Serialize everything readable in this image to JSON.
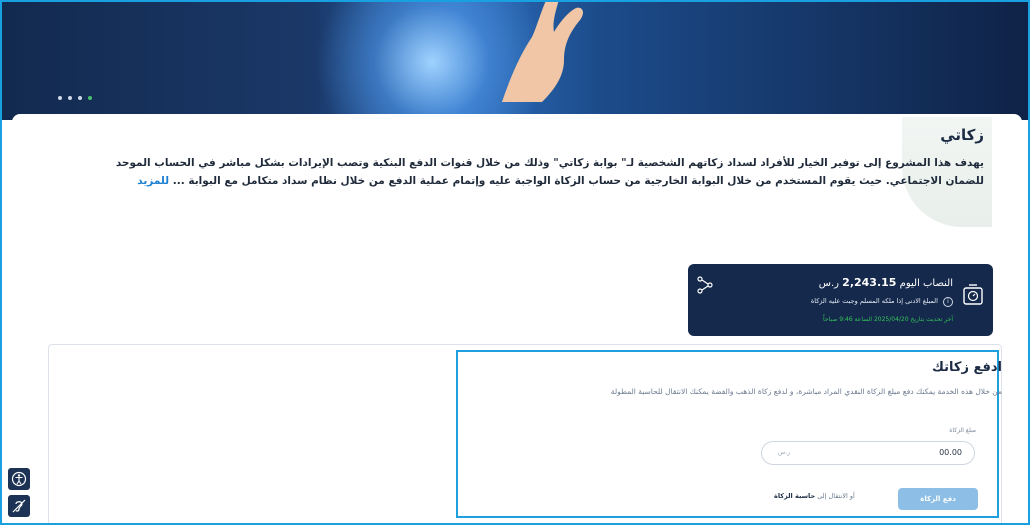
{
  "hero": {
    "slides": 4,
    "active_slide": 4
  },
  "intro": {
    "title": "زكاتي",
    "description": "يهدف هذا المشروع إلى توفير الخيار للأفراد لسداد زكاتهم الشخصية لـ\" بوابة زكاتي\" وذلك من خلال قنوات الدفع البنكية وتصب الإيرادات بشكل مباشر في الحساب الموحد للضمان الاجتماعي. حيث يقوم المستخدم من خلال البوابة الخارجية من حساب الزكاة الواجبة عليه وإتمام عملية الدفع من خلال نظام سداد متكامل مع البوابة ...",
    "more_link": "للمزيد"
  },
  "nisab": {
    "label": "النصاب اليوم",
    "value": "2,243.15",
    "currency": "ر.س",
    "note": "المبلغ الادنى إذا ملكه المسلم وجبت عليه الزكاة",
    "update": "آخر تحديث بتاريخ 2025/04/20 الساعة 9:46 صباحاً"
  },
  "pay": {
    "title": "ادفع زكاتك",
    "description": "من خلال هذه الخدمة يمكنك دفع مبلغ الزكاة النقدي المراد مباشرة، و لدفع زكاة الذهب والفضة يمكنك الانتقال للحاسبة المطولة",
    "amount_label": "مبلغ الزكاة",
    "amount_value": "00.00",
    "currency": "ر.س",
    "button": "دفع الزكاة",
    "calc_prefix": "أو الانتقال إلى",
    "calc_link": "حاسبة الزكاة"
  },
  "colors": {
    "accent": "#1ea0de",
    "navy": "#14294b",
    "green": "#35c45a",
    "link": "#1d7fd1"
  },
  "icons": [
    "scale-icon",
    "share-icon",
    "info-icon",
    "accessibility-icon",
    "hearing-icon"
  ]
}
